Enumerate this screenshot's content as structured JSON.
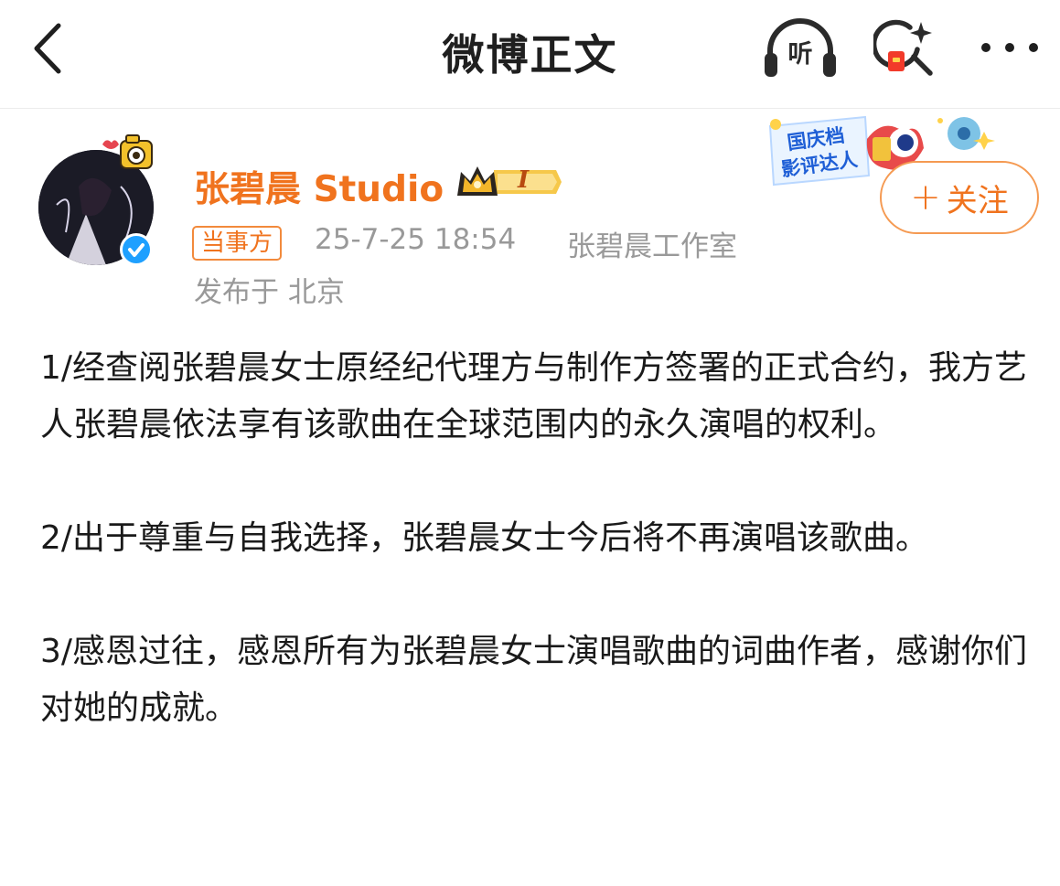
{
  "nav": {
    "title": "微博正文",
    "listen_label": "听"
  },
  "author": {
    "name": "张碧晨 Studio",
    "party_tag": "当事方",
    "timestamp": "25-7-25 18:54",
    "source": "张碧晨工作室",
    "location": "发布于 北京",
    "vip_level": "I"
  },
  "badge": {
    "line1": "国庆档",
    "line2": "影评达人"
  },
  "follow": {
    "plus": "+",
    "label": "关注"
  },
  "post": {
    "paragraphs": [
      "1/经查阅张碧晨女士原经纪代理方与制作方签署的正式合约，我方艺人张碧晨依法享有该歌曲在全球范围内的永久演唱的权利。",
      "2/出于尊重与自我选择，张碧晨女士今后将不再演唱该歌曲。",
      "3/感恩过往，感恩所有为张碧晨女士演唱歌曲的词曲作者，感谢你们对她的成就。"
    ]
  },
  "colors": {
    "accent": "#f0731e",
    "meta": "#999999",
    "verified": "#1ea0ff"
  },
  "icons": [
    "back-icon",
    "headphones-icon",
    "search-icon",
    "more-icon",
    "verified-icon",
    "crown-icon"
  ]
}
